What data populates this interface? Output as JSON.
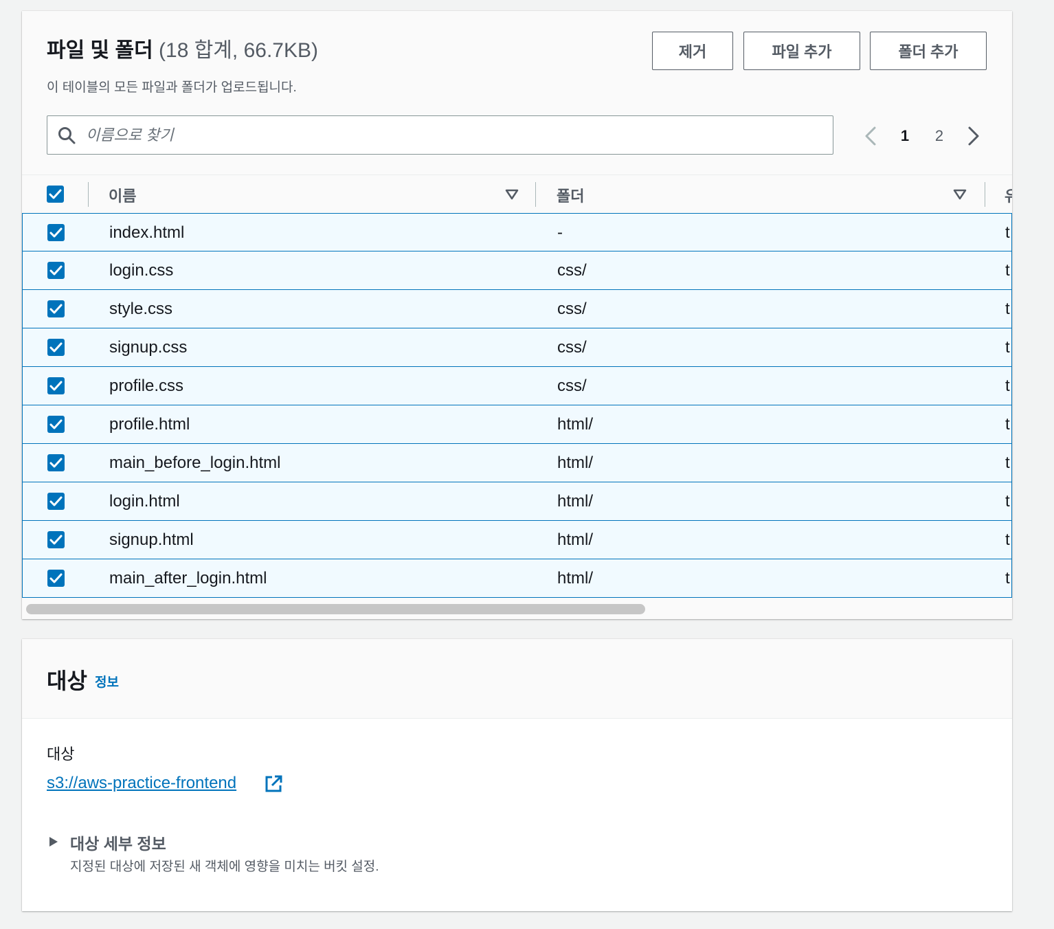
{
  "files_panel": {
    "title": "파일 및 폴더",
    "count_summary": "(18 합계, 66.7KB)",
    "description": "이 테이블의 모든 파일과 폴더가 업로드됩니다.",
    "buttons": {
      "remove": "제거",
      "add_files": "파일 추가",
      "add_folder": "폴더 추가"
    },
    "search": {
      "placeholder": "이름으로 찾기",
      "value": ""
    },
    "pagination": {
      "current_page": "1",
      "next_page": "2"
    },
    "table": {
      "columns": {
        "name": "이름",
        "folder": "폴더",
        "third": "유"
      },
      "rows": [
        {
          "name": "index.html",
          "folder": "-",
          "extra": "t"
        },
        {
          "name": "login.css",
          "folder": "css/",
          "extra": "t"
        },
        {
          "name": "style.css",
          "folder": "css/",
          "extra": "t"
        },
        {
          "name": "signup.css",
          "folder": "css/",
          "extra": "t"
        },
        {
          "name": "profile.css",
          "folder": "css/",
          "extra": "t"
        },
        {
          "name": "profile.html",
          "folder": "html/",
          "extra": "t"
        },
        {
          "name": "main_before_login.html",
          "folder": "html/",
          "extra": "t"
        },
        {
          "name": "login.html",
          "folder": "html/",
          "extra": "t"
        },
        {
          "name": "signup.html",
          "folder": "html/",
          "extra": "t"
        },
        {
          "name": "main_after_login.html",
          "folder": "html/",
          "extra": "t"
        }
      ]
    }
  },
  "destination_panel": {
    "title": "대상",
    "info_link": "정보",
    "label": "대상",
    "link": "s3://aws-practice-frontend",
    "details": {
      "title": "대상 세부 정보",
      "description": "지정된 대상에 저장된 새 객체에 영향을 미치는 버킷 설정."
    }
  },
  "colors": {
    "accent": "#0073bb",
    "selected_row_bg": "#f1faff",
    "text_primary": "#16191f",
    "text_secondary": "#545b64"
  }
}
